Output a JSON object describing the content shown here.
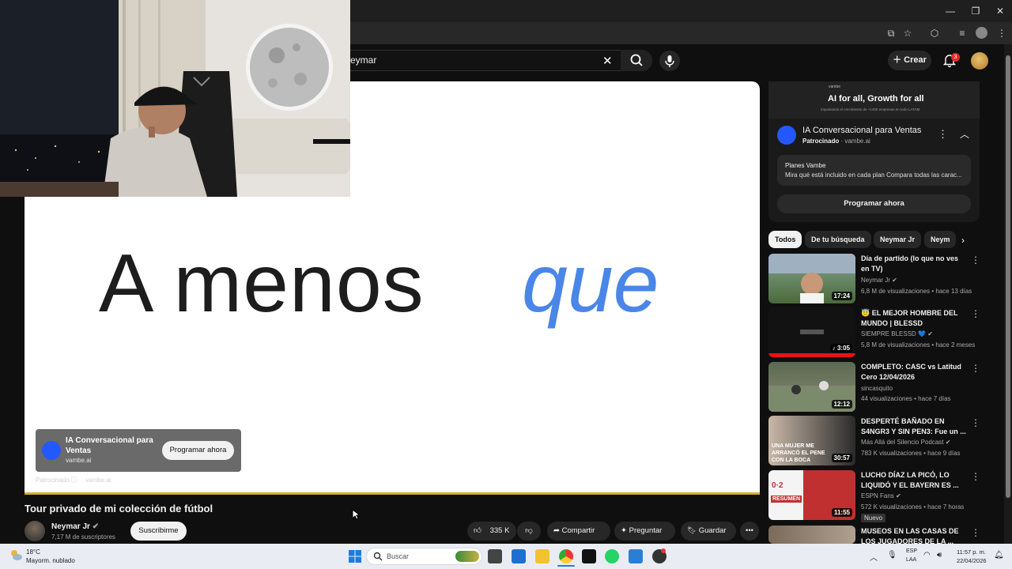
{
  "search": {
    "query": "eymar"
  },
  "header": {
    "create_label": "Crear",
    "notif_count": "3"
  },
  "video": {
    "caption_dark": "A menos",
    "caption_blue": "que",
    "ad_overlay": {
      "title": "IA Conversacional para Ventas",
      "domain": "vambe.ai",
      "cta": "Programar ahora",
      "footer_sponsored": "Patrocinado",
      "footer_domain": "vambe.ai"
    }
  },
  "watch": {
    "title": "Tour privado de mi colección de fútbol",
    "channel": "Neymar Jr",
    "subscribers": "7,17 M de suscriptores",
    "subscribe_label": "Suscribirme",
    "likes": "335 K",
    "share_label": "Compartir",
    "ask_label": "Preguntar",
    "save_label": "Guardar"
  },
  "sidebar_ad": {
    "banner_small": "vambe",
    "banner_main": "AI for all, Growth for all",
    "banner_sub": "Impulsando el crecimiento de +1400 empresas en todo LATAM",
    "title": "IA Conversacional para Ventas",
    "sponsored": "Patrocinado",
    "domain": "vambe.ai",
    "card_title": "Planes Vambe",
    "card_desc": "Mira qué está incluido en cada plan Compara todas las carac...",
    "cta": "Programar ahora"
  },
  "chips": [
    "Todos",
    "De tu búsqueda",
    "Neymar Jr",
    "Neym"
  ],
  "recommendations": [
    {
      "title": "Día de partido (lo que no ves en TV)",
      "channel": "Neymar Jr",
      "meta": "6,8 M de visualizaciones • hace 13 días",
      "duration": "17:24"
    },
    {
      "title": "😇 EL MEJOR HOMBRE DEL MUNDO | BLESSD",
      "channel": "SIEMPRE BLESSD 💙",
      "meta": "5,8 M de visualizaciones • hace 2 meses",
      "duration": "3:05"
    },
    {
      "title": "COMPLETO: CASC vs Latitud Cero 12/04/2026",
      "channel": "sincasquito",
      "meta": "44 visualizaciones • hace 7 días",
      "duration": "12:12"
    },
    {
      "title": "DESPERTÉ BAÑADO EN S4NGR3 Y SIN PEN3: Fue un ...",
      "channel": "Más Allá del Silencio Podcast",
      "meta": "783 K visualizaciones • hace 9 días",
      "duration": "30:57",
      "thumb_text": "UNA MUJER ME ARRANCÓ EL PENE CON LA BOCA"
    },
    {
      "title": "LUCHO DÍAZ LA PICÓ, LO LIQUIDÓ Y EL BAYERN ES ...",
      "channel": "ESPN Fans",
      "meta": "572 K visualizaciones • hace 7 horas",
      "duration": "11:55",
      "badge": "Nuevo",
      "thumb_text": "RESUMEN"
    },
    {
      "title": "MUSEOS EN LAS CASAS DE LOS JUGADORES DE LA ...",
      "channel": "",
      "meta": "",
      "duration": ""
    }
  ],
  "taskbar": {
    "weather_temp": "18°C",
    "weather_desc": "Mayorm. nublado",
    "search_placeholder": "Buscar",
    "lang1": "ESP",
    "lang2": "LAA",
    "time": "11:57 p. m.",
    "date": "22/04/2026"
  }
}
